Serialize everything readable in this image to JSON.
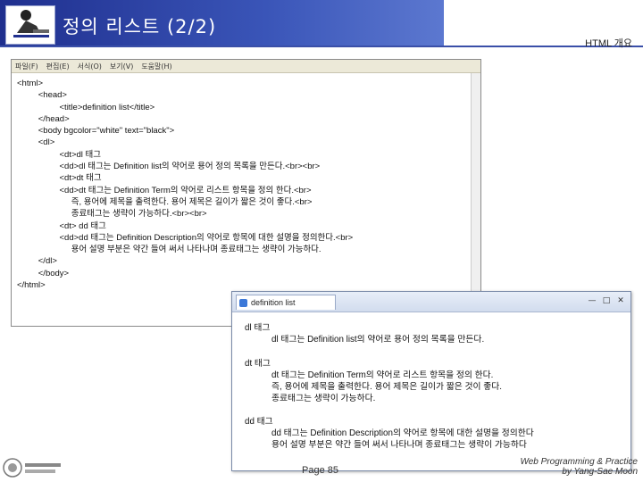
{
  "slide": {
    "title": "정의 리스트 (2/2)",
    "section": "HTML 개요",
    "page": "Page 85",
    "credit_line1": "Web Programming & Practice",
    "credit_line2": "by Yang-Sae Moon"
  },
  "editor": {
    "menu": [
      "파일(F)",
      "편집(E)",
      "서식(O)",
      "보기(V)",
      "도움말(H)"
    ],
    "lines": [
      "<html>",
      "         <head>",
      "                  <title>definition list</title>",
      "         </head>",
      "         <body bgcolor=\"white\" text=\"black\">",
      "         <dl>",
      "                  <dt>dl 태그",
      "                  <dd>dl 태그는 Definition list의 약어로 용어 정의 목록을 만든다.<br><br>",
      "                  <dt>dt 태그",
      "                  <dd>dt 태그는 Definition Term의 약어로 리스트 항목을 정의 한다.<br>",
      "                       즉, 용어에 제목을 출력한다. 용어 제목은 길이가 짧은 것이 좋다.<br>",
      "                       종료태그는 생략이 가능하다.<br><br>",
      "                  <dt> dd 태그",
      "                  <dd>dd 태그는 Definition Description의 약어로 항목에 대한 설명을 정의한다.<br>",
      "                       용어 설명 부분은 약간 들여 써서 나타나며 종료태그는 생략이 가능하다.",
      "         </dl>",
      "         </body>",
      "</html>"
    ]
  },
  "browser": {
    "tab_title": "definition list",
    "dl_title": "dl 태그",
    "dl_desc": "dl 태그는 Definition list의 약어로 용어 정의 목록을 만든다.",
    "dt_title": "dt 태그",
    "dt_desc1": "dt 태그는 Definition Term의 약어로 리스트 항목을 정의 한다.",
    "dt_desc2": "즉, 용어에 제목을 출력한다. 용어 제목은 길이가 짧은 것이 좋다.",
    "dt_desc3": "종료태그는 생략이 가능하다.",
    "dd_title": "dd 태그",
    "dd_desc1": "dd 태그는 Definition Description의 약어로 항목에 대한 설명을 정의한다",
    "dd_desc2": "용어 설명 부분은 약간 들여 써서 나타나며 종료태그는 생략이 가능하다"
  }
}
